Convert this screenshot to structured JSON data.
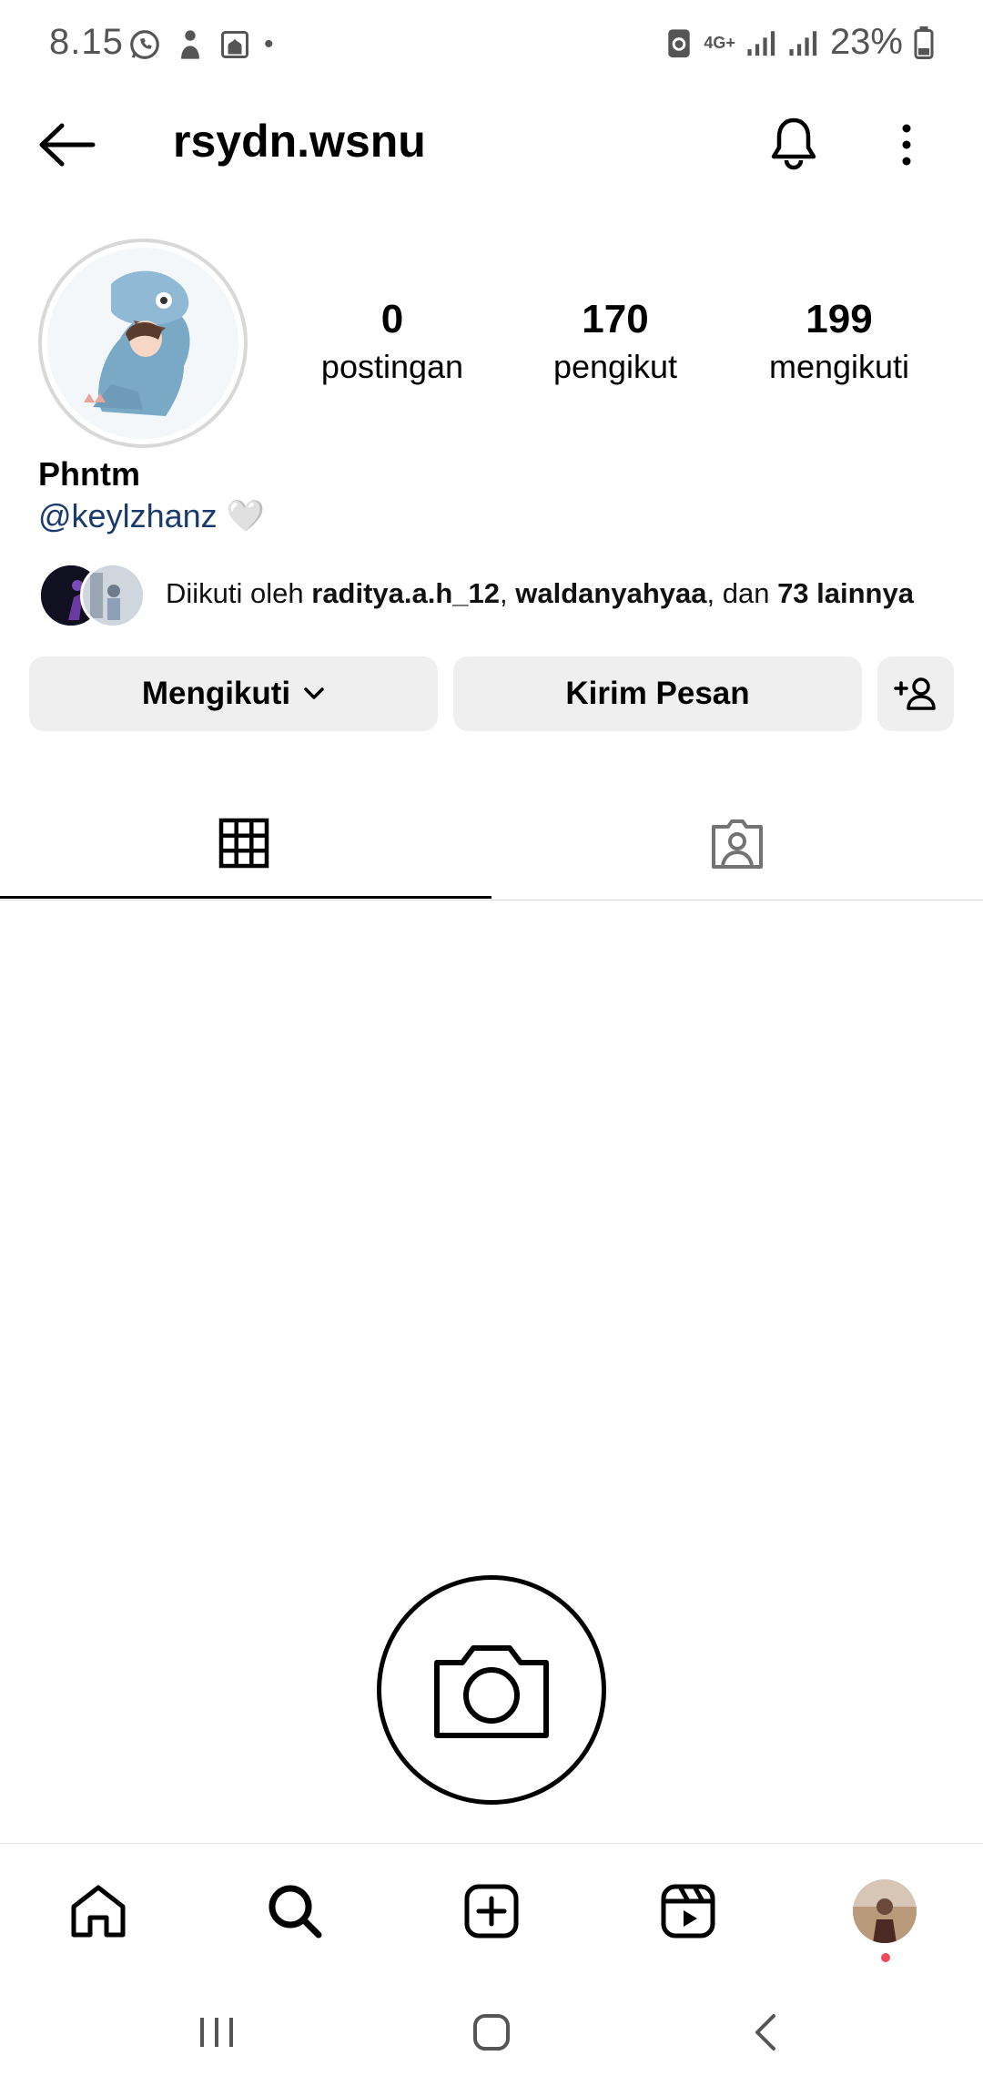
{
  "status_bar": {
    "time": "8.15",
    "network": "4G+",
    "battery": "23%"
  },
  "header": {
    "username": "rsydn.wsnu"
  },
  "profile": {
    "stats": [
      {
        "value": "0",
        "label": "postingan"
      },
      {
        "value": "170",
        "label": "pengikut"
      },
      {
        "value": "199",
        "label": "mengikuti"
      }
    ],
    "display_name": "Phntm",
    "bio_link": "@keylzhanz",
    "bio_emoji": "🤍"
  },
  "followed_by": {
    "prefix": "Diikuti oleh ",
    "user1": "raditya.a.h_12",
    "sep": ", ",
    "user2": "waldanyahyaa",
    "mid": ", dan ",
    "others": "73 lainnya"
  },
  "actions": {
    "following": "Mengikuti",
    "message": "Kirim Pesan"
  },
  "tabs": [
    "grid-tab",
    "tagged-tab"
  ],
  "colors": {
    "button_bg": "#efefef",
    "link": "#1a3a6e",
    "notification_dot": "#ed4956"
  }
}
